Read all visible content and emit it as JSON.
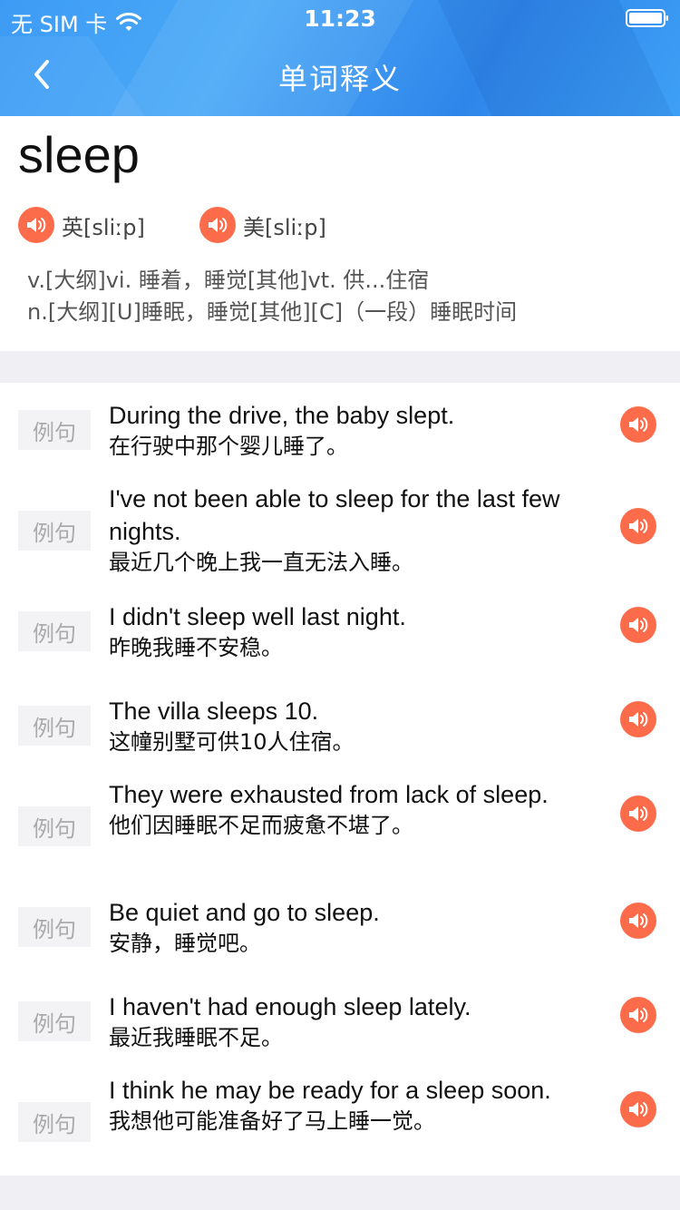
{
  "status": {
    "carrier": "无 SIM 卡",
    "time": "11:23"
  },
  "nav": {
    "title": "单词释义"
  },
  "word": {
    "text": "sleep",
    "uk_label": "英[sliːp]",
    "us_label": "美[sliːp]",
    "definitions": [
      "v.[大纲]vi. 睡着，睡觉[其他]vt. 供...住宿",
      "n.[大纲][U]睡眠，睡觉[其他][C]（一段）睡眠时间"
    ]
  },
  "examples": {
    "tag_label": "例句",
    "items": [
      {
        "en": "During the drive, the baby slept.",
        "zh": "在行驶中那个婴儿睡了。"
      },
      {
        "en": "I've not been able to sleep for the last few nights.",
        "zh": "最近几个晚上我一直无法入睡。"
      },
      {
        "en": "I didn't sleep well last night.",
        "zh": "昨晚我睡不安稳。"
      },
      {
        "en": "The villa sleeps 10.",
        "zh": "这幢别墅可供10人住宿。"
      },
      {
        "en": "They were exhausted from lack of sleep.",
        "zh": "他们因睡眠不足而疲惫不堪了。"
      },
      {
        "en": "Be quiet and go to sleep.",
        "zh": "安静，睡觉吧。"
      },
      {
        "en": "I haven't had enough sleep lately.",
        "zh": "最近我睡眠不足。"
      },
      {
        "en": "I think he may be ready for a sleep soon.",
        "zh": "我想他可能准备好了马上睡一觉。"
      }
    ]
  },
  "colors": {
    "header": "#3d9bf5",
    "speaker": "#fc6c4a",
    "background": "#efeff4"
  },
  "icons": {
    "back": "chevron-left-icon",
    "speaker": "speaker-icon",
    "wifi": "wifi-icon",
    "battery": "battery-icon"
  }
}
